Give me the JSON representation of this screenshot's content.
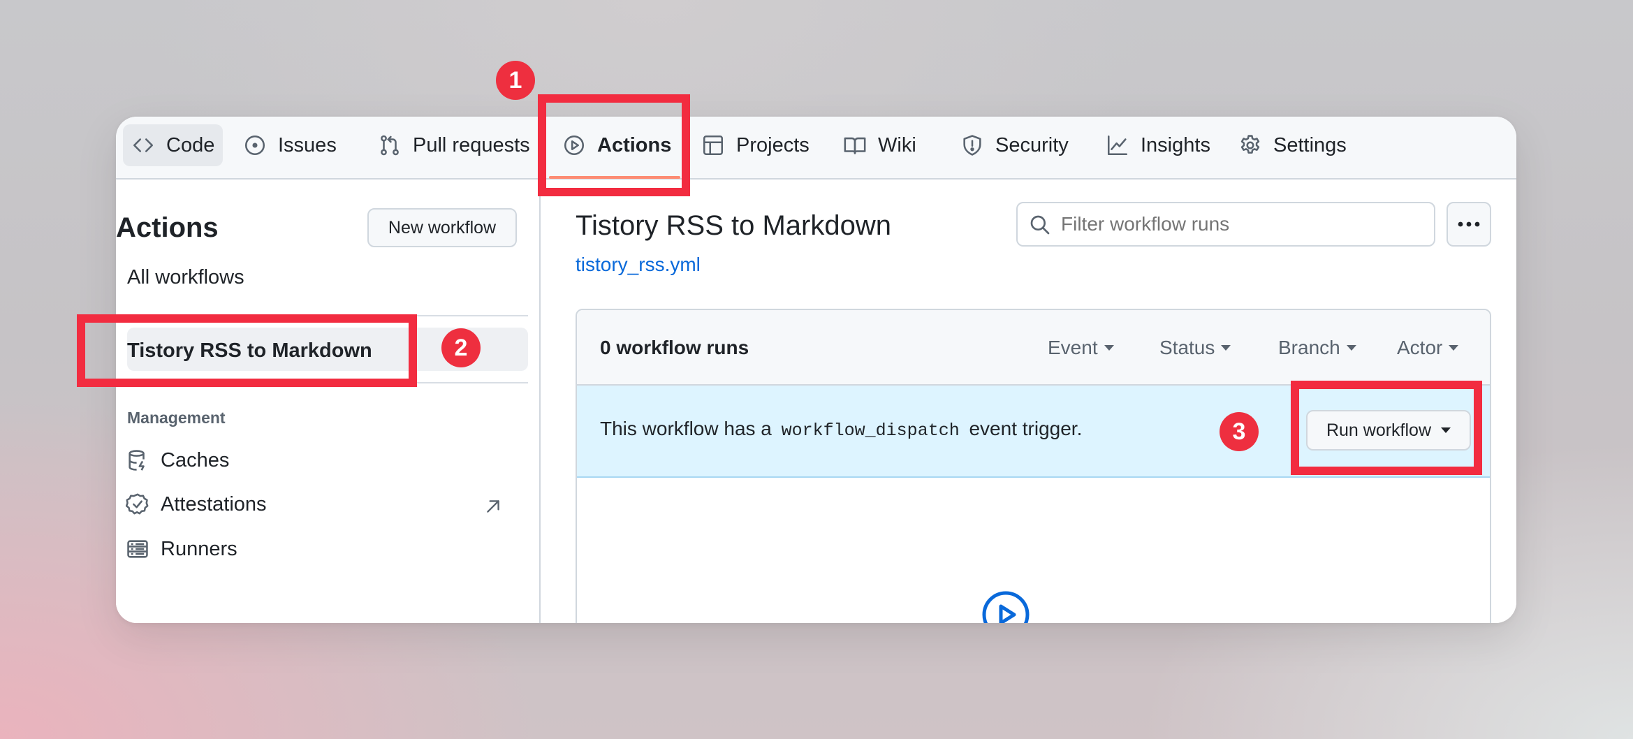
{
  "tabs": {
    "code": "Code",
    "issues": "Issues",
    "pull_requests": "Pull requests",
    "actions": "Actions",
    "projects": "Projects",
    "wiki": "Wiki",
    "security": "Security",
    "insights": "Insights",
    "settings": "Settings"
  },
  "sidebar": {
    "heading": "Actions",
    "new_workflow": "New workflow",
    "all_workflows": "All workflows",
    "selected_workflow": "Tistory RSS to Markdown",
    "management_label": "Management",
    "management_items": [
      "Caches",
      "Attestations",
      "Runners"
    ]
  },
  "main": {
    "title": "Tistory RSS to Markdown",
    "file": "tistory_rss.yml",
    "search_placeholder": "Filter workflow runs",
    "runs_count": "0 workflow runs",
    "filters": [
      "Event",
      "Status",
      "Branch",
      "Actor"
    ],
    "banner": {
      "prefix": "This workflow has a",
      "code": "workflow_dispatch",
      "suffix": "event trigger."
    },
    "run_button": "Run workflow"
  },
  "annotations": {
    "badges": [
      "1",
      "2",
      "3"
    ],
    "color": "#f22c40"
  },
  "colors": {
    "link": "#0969da",
    "active_underline": "#fd8c73",
    "banner_bg": "#ddf4ff"
  }
}
